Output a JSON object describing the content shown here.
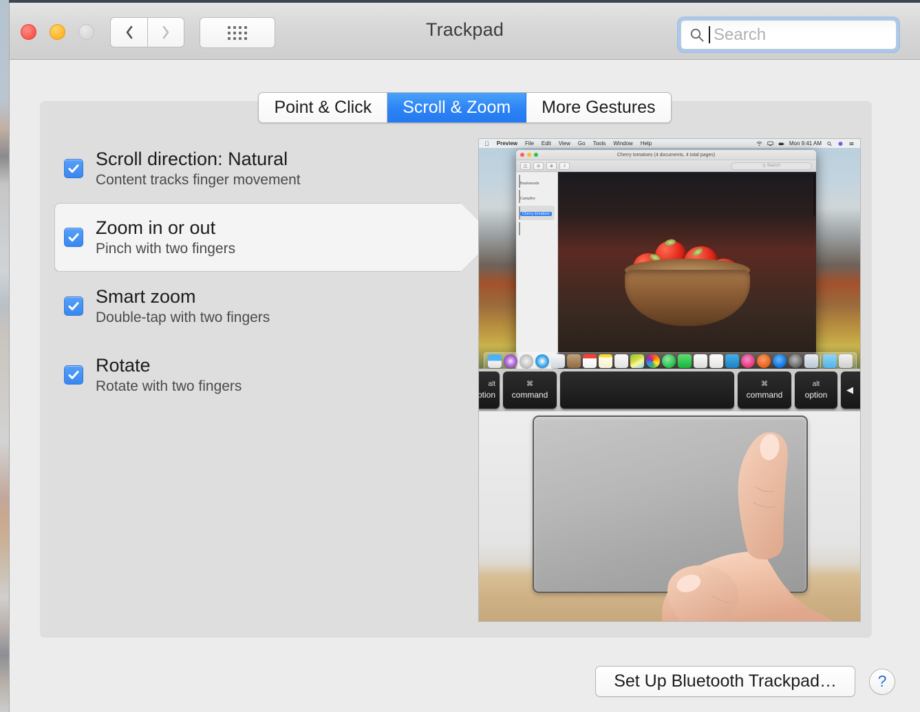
{
  "window": {
    "title": "Trackpad",
    "traffic_lights": [
      {
        "name": "close",
        "color": "#f9574e"
      },
      {
        "name": "minimize",
        "color": "#fdb62a"
      },
      {
        "name": "zoom",
        "color": "#d8d8d8"
      }
    ],
    "nav": {
      "back_icon": "chevron-left-icon",
      "forward_icon": "chevron-right-icon"
    },
    "grid_button_icon": "show-all-grid-icon"
  },
  "search": {
    "placeholder": "Search",
    "value": "",
    "icon": "search-icon",
    "focused": true
  },
  "tabs": [
    {
      "label": "Point & Click",
      "selected": false
    },
    {
      "label": "Scroll & Zoom",
      "selected": true
    },
    {
      "label": "More Gestures",
      "selected": false
    }
  ],
  "options": [
    {
      "title": "Scroll direction: Natural",
      "subtitle": "Content tracks finger movement",
      "checked": true,
      "selected": false
    },
    {
      "title": "Zoom in or out",
      "subtitle": "Pinch with two fingers",
      "checked": true,
      "selected": true
    },
    {
      "title": "Smart zoom",
      "subtitle": "Double-tap with two fingers",
      "checked": true,
      "selected": false
    },
    {
      "title": "Rotate",
      "subtitle": "Rotate with two fingers",
      "checked": true,
      "selected": false
    }
  ],
  "demo": {
    "menubar": {
      "apple": "",
      "app": "Preview",
      "items": [
        "File",
        "Edit",
        "View",
        "Go",
        "Tools",
        "Window",
        "Help"
      ],
      "clock": "Mon 9:41 AM",
      "status_icons": [
        "wifi-icon",
        "airplay-icon",
        "battery-icon",
        "spotlight-icon",
        "siri-icon",
        "notification-center-icon"
      ]
    },
    "preview_window": {
      "title": "Cherry tomatoes (4 documents, 4 total pages)",
      "search_placeholder": "Search",
      "thumbnails": [
        {
          "label": "Backwoods",
          "selected": false
        },
        {
          "label": "Campfire",
          "selected": false
        },
        {
          "label": "Cherry tomatoes",
          "selected": true
        },
        {
          "label": "",
          "selected": false
        }
      ]
    },
    "keyboard": [
      {
        "top": "alt",
        "bottom": "option"
      },
      {
        "top": "⌘",
        "bottom": "command"
      },
      {
        "top": "",
        "bottom": ""
      },
      {
        "top": "⌘",
        "bottom": "command"
      },
      {
        "top": "alt",
        "bottom": "option"
      },
      {
        "top": "◀",
        "bottom": ""
      }
    ],
    "trackpad_gesture": "pinch-two-fingers"
  },
  "footer": {
    "bluetooth_button": "Set Up Bluetooth Trackpad…",
    "help_button": "?"
  },
  "colors": {
    "accent_blue": "#3a87f0",
    "tab_selected": "#2d84f4",
    "window_bg": "#ececec",
    "panel_bg": "#dededf",
    "help_blue": "#1f6fdc"
  }
}
